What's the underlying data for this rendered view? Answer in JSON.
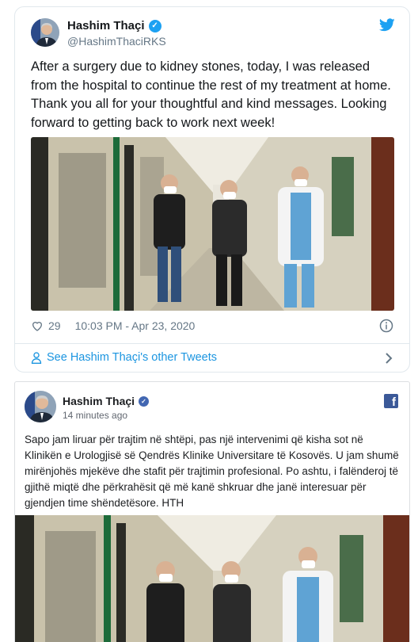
{
  "tweet": {
    "name": "Hashim Thaçi",
    "handle": "@HashimThaciRKS",
    "text": "After a surgery due to kidney stones, today, I was released from the hospital to continue the rest of my treatment at home. Thank you all for your thoughtful and kind messages. Looking forward to getting back to work next week!",
    "likes": "29",
    "timestamp": "10:03 PM - Apr 23, 2020",
    "more_link": "See Hashim Thaçi's other Tweets",
    "brand_color": "#1da1f2",
    "link_color": "#1b95e0"
  },
  "facebook_post": {
    "name": "Hashim Thaçi",
    "time": "14 minutes ago",
    "logo_letter": "f",
    "text": "Sapo jam liruar për trajtim në shtëpi, pas një intervenimi që kisha sot në Klinikën e Urologjisë së Qendrës Klinike Universitare të Kosovës. U jam shumë mirënjohës mjekëve dhe stafit për trajtimin profesional. Po ashtu, i falënderoj të gjithë miqtë dhe përkrahësit që më kanë shkruar dhe janë interesuar për gjendjen time shëndetësore. HTH",
    "brand_color": "#3b5998"
  }
}
